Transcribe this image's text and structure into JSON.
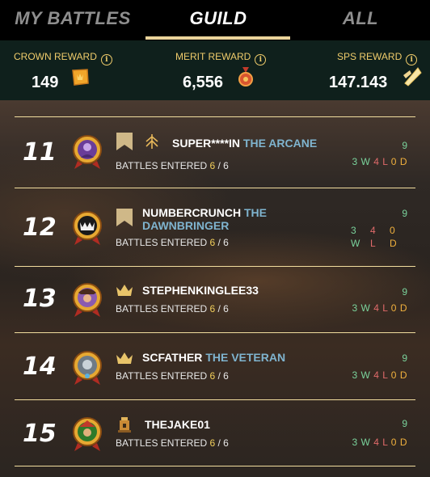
{
  "tabs": {
    "my_battles": "MY BATTLES",
    "guild": "GUILD",
    "all": "ALL"
  },
  "rewards": {
    "crown": {
      "label": "CROWN REWARD",
      "value": "149",
      "icon": "crown-coin-icon"
    },
    "merit": {
      "label": "MERIT REWARD",
      "value": "6,556",
      "icon": "merit-medal-icon"
    },
    "sps": {
      "label": "SPS REWARD",
      "value": "147.143",
      "icon": "sps-shard-icon"
    },
    "info_glyph": "i"
  },
  "colors": {
    "accent_gold": "#f0cc6b",
    "title_blue": "#7fb4cf",
    "win_green": "#7ad39c",
    "loss_red": "#e06a6a",
    "draw_orange": "#f0b03d"
  },
  "entered_label": "BATTLES ENTERED",
  "rows": [
    {
      "rank": "11",
      "name": "SUPER****IN",
      "title": "THE ARCANE",
      "entered": "6",
      "of": "/ 6",
      "total": "9",
      "w": "3",
      "l": "4",
      "d": "0",
      "badge": "guild-banner-icon",
      "extra_icon": "arcane-emblem-icon"
    },
    {
      "rank": "12",
      "name": "NUMBERCRUNCH",
      "title": "THE DAWNBRINGER",
      "entered": "6",
      "of": "/ 6",
      "total": "9",
      "w": "3",
      "l": "4",
      "d": "0",
      "badge": "guild-banner-icon"
    },
    {
      "rank": "13",
      "name": "STEPHENKINGLEE33",
      "title": "",
      "entered": "6",
      "of": "/ 6",
      "total": "9",
      "w": "3",
      "l": "4",
      "d": "0",
      "badge": "crown-icon"
    },
    {
      "rank": "14",
      "name": "SCFATHER",
      "title": "THE VETERAN",
      "entered": "6",
      "of": "/ 6",
      "total": "9",
      "w": "3",
      "l": "4",
      "d": "0",
      "badge": "crown-icon"
    },
    {
      "rank": "15",
      "name": "THEJAKE01",
      "title": "",
      "entered": "6",
      "of": "/ 6",
      "total": "9",
      "w": "3",
      "l": "4",
      "d": "0",
      "badge": "guild-tower-icon"
    }
  ],
  "wld_letters": {
    "w": "W",
    "l": "L",
    "d": "D"
  }
}
